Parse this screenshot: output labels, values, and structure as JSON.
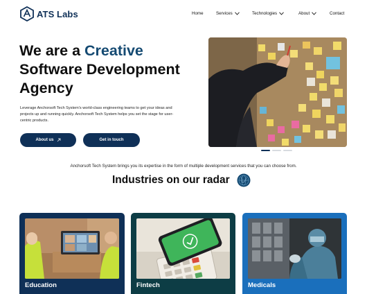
{
  "nav": {
    "brand": "ATS Labs",
    "items": [
      {
        "label": "Home",
        "dropdown": false
      },
      {
        "label": "Services",
        "dropdown": true
      },
      {
        "label": "Technologies",
        "dropdown": true
      },
      {
        "label": "About",
        "dropdown": true
      },
      {
        "label": "Contact",
        "dropdown": false
      }
    ]
  },
  "hero": {
    "title_part1": "We are a ",
    "title_accent": "Creative",
    "title_part2": "Software Development Agency",
    "description": "Leverage Anchorsoft Tech System's world-class engineering teams to get your ideas and projects up and running quickly. Anchorsoft Tech System helps you set the stage for user-centric products.",
    "primary_button": "About us",
    "secondary_button": "Get in touch",
    "slide_count": 3,
    "active_slide": 1
  },
  "intro_text": "Anchorsoft Tech System brings you its expertise in the form of multiple development services that you can choose from.",
  "industries": {
    "title": "Industries on our radar",
    "cards": [
      {
        "label": "Education",
        "color": "#0f3057"
      },
      {
        "label": "Fintech",
        "color": "#0d3d45"
      },
      {
        "label": "Medicals",
        "color": "#1a6fbc"
      }
    ]
  },
  "colors": {
    "brand_navy": "#0f3057",
    "accent_blue": "#154a72"
  }
}
